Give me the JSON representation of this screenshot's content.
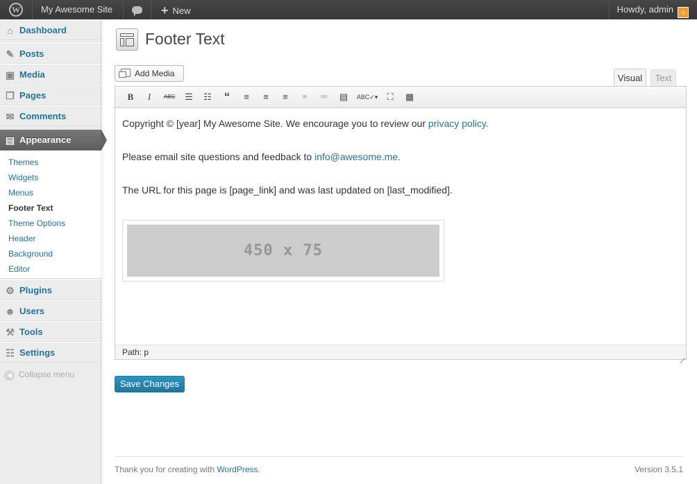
{
  "admin_bar": {
    "site_name": "My Awesome Site",
    "new_label": "New",
    "howdy": "Howdy, admin"
  },
  "sidebar": {
    "items": [
      {
        "label": "Dashboard",
        "icon": "dashboard-icon"
      },
      {
        "label": "Posts",
        "icon": "pushpin-icon"
      },
      {
        "label": "Media",
        "icon": "media-icon"
      },
      {
        "label": "Pages",
        "icon": "pages-icon"
      },
      {
        "label": "Comments",
        "icon": "comments-icon"
      },
      {
        "label": "Appearance",
        "icon": "appearance-icon"
      },
      {
        "label": "Plugins",
        "icon": "plugins-icon"
      },
      {
        "label": "Users",
        "icon": "users-icon"
      },
      {
        "label": "Tools",
        "icon": "tools-icon"
      },
      {
        "label": "Settings",
        "icon": "settings-icon"
      }
    ],
    "submenu": [
      "Themes",
      "Widgets",
      "Menus",
      "Footer Text",
      "Theme Options",
      "Header",
      "Background",
      "Editor"
    ],
    "current_submenu": "Footer Text",
    "collapse": "Collapse menu"
  },
  "page": {
    "title": "Footer Text"
  },
  "editor": {
    "add_media": "Add Media",
    "tab_visual": "Visual",
    "tab_text": "Text",
    "toolbar": [
      "bold",
      "italic",
      "strikethrough",
      "bullet-list",
      "numbered-list",
      "blockquote",
      "align-left",
      "align-center",
      "align-right",
      "insert-link",
      "unlink",
      "insert-more",
      "spellcheck",
      "fullscreen",
      "kitchen-sink"
    ],
    "content": {
      "p1_text": "Copyright © [year] My Awesome Site. We encourage you to review our ",
      "p1_link": "privacy policy.",
      "p2_text": "Please email site questions and feedback to ",
      "p2_link": "info@awesome.me.",
      "p3_text": "The URL for this page is [page_link] and was last updated on [last_modified].",
      "placeholder_image": "450 x 75"
    },
    "path": "Path: p"
  },
  "save_button": "Save Changes",
  "footer": {
    "thanks_prefix": "Thank you for creating with ",
    "thanks_link": "WordPress",
    "thanks_suffix": ".",
    "version": "Version 3.5.1"
  },
  "colors": {
    "link": "#21759b",
    "admin_bar": "#464646",
    "active_menu": "#6d6d6d",
    "primary_button": "#21759b"
  }
}
